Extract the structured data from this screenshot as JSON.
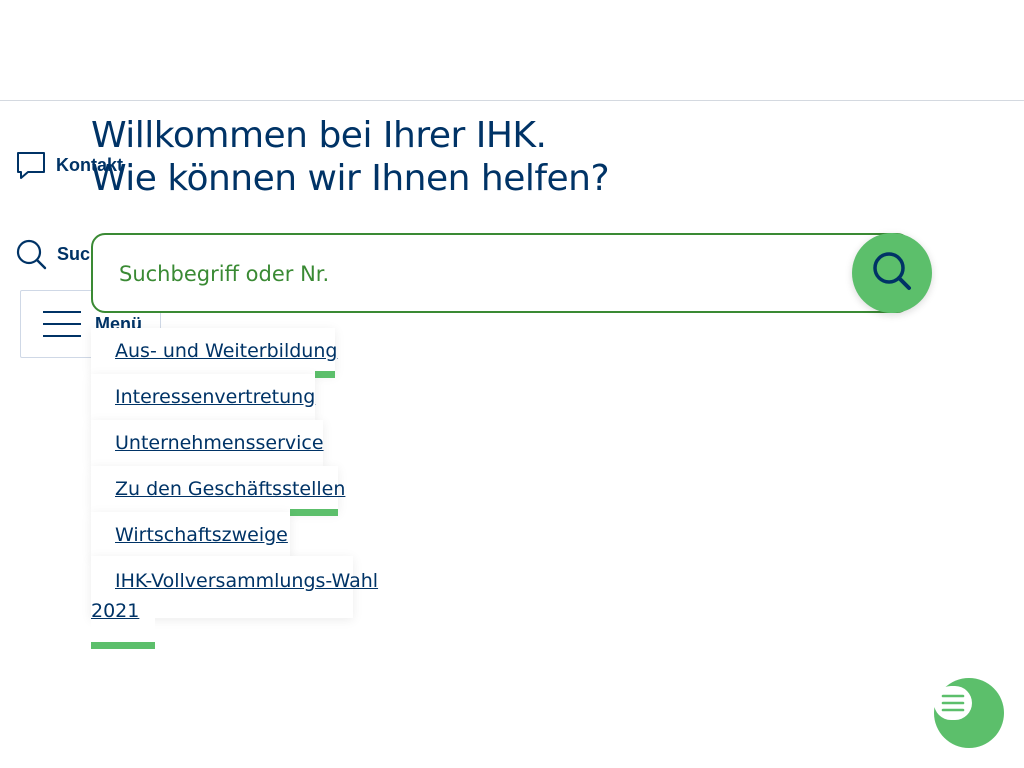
{
  "header": {},
  "sidebar": {
    "contact_label": "Kontakt",
    "search_label": "Suche",
    "menu_label": "Menü"
  },
  "hero": {
    "line1": "Willkommen bei Ihrer IHK.",
    "line2": "Wie können wir Ihnen helfen?"
  },
  "search": {
    "placeholder": "Suchbegriff oder Nr.",
    "value": ""
  },
  "quick_links": [
    "Aus- und Weiterbildung",
    "Interessenvertretung",
    "Unternehmensservice",
    "Zu den Geschäftsstellen",
    "Wirtschaftszweige",
    "IHK-Vollversammlungs-Wahl",
    "2021"
  ],
  "colors": {
    "primary_text": "#003366",
    "accent_green": "#5cbf6b",
    "search_border": "#3a8a34"
  },
  "icons": {
    "contact": "chat-bubble-outline-icon",
    "search": "magnifier-icon",
    "menu": "hamburger-icon",
    "chat": "chat-bot-icon"
  }
}
